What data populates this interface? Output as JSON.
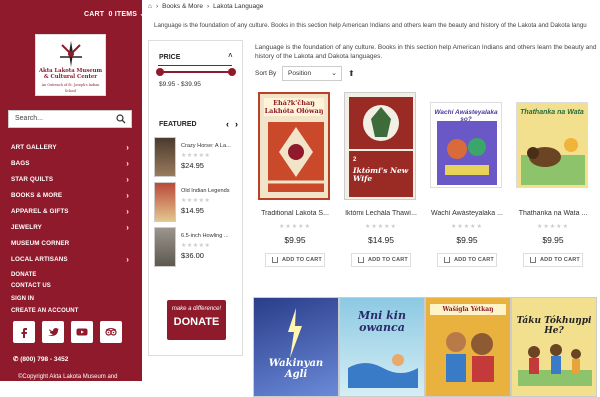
{
  "header": {
    "cart_label": "CART",
    "cart_items": "0 ITEMS"
  },
  "logo": {
    "line1": "Akta Lakota Museum",
    "line2": "& Cultural Center",
    "tagline": "An Outreach of St. Joseph's Indian School"
  },
  "search": {
    "placeholder": "Search..."
  },
  "nav": {
    "items": [
      {
        "label": "ART GALLERY"
      },
      {
        "label": "BAGS"
      },
      {
        "label": "STAR QUILTS"
      },
      {
        "label": "BOOKS & MORE"
      },
      {
        "label": "APPAREL & GIFTS"
      },
      {
        "label": "JEWELRY"
      },
      {
        "label": "MUSEUM CORNER"
      },
      {
        "label": "LOCAL ARTISANS"
      }
    ]
  },
  "links": {
    "items": [
      {
        "label": "DONATE"
      },
      {
        "label": "CONTACT US"
      },
      {
        "label": "SIGN IN"
      },
      {
        "label": "CREATE AN ACCOUNT"
      }
    ]
  },
  "social": [
    {
      "icon": "facebook-icon"
    },
    {
      "icon": "twitter-icon"
    },
    {
      "icon": "youtube-icon"
    },
    {
      "icon": "tripadvisor-icon"
    }
  ],
  "contact": {
    "phone": "(800) 798 - 3452",
    "copyright": "©Copyright Akta Lakota Museum and"
  },
  "breadcrumb": {
    "items": [
      "Books & More",
      "Lakota Language"
    ]
  },
  "description_top": "Language is the foundation of any culture. Books in this section help American Indians and others learn the beauty and history of the Lakota and Dakota langu",
  "description_main": "Language is the foundation of any culture. Books in this section help American Indians and others learn the beauty and history of the Lakota and Dakota languages.",
  "filters": {
    "price_title": "PRICE",
    "price_range": "$9.95 - $39.95",
    "price_min": 9.95,
    "price_max": 39.95,
    "featured_title": "FEATURED"
  },
  "featured": [
    {
      "name": "Crazy Horse: A La...",
      "price": "$24.95",
      "stars": "★★★★★"
    },
    {
      "name": "Old Indian Legends",
      "price": "$14.95",
      "stars": "★★★★★"
    },
    {
      "name": "6.5-inch Howling ...",
      "price": "$36.00",
      "stars": "★★★★★"
    }
  ],
  "donate": {
    "line1": "make a difference!",
    "line2": "DONATE"
  },
  "sort": {
    "label": "Sort By",
    "selected": "Position"
  },
  "products": [
    {
      "name": "Traditional Lakota S...",
      "price": "$9.95",
      "stars": "★★★★★",
      "button": "ADD TO CART",
      "cover_title": "Ehá?k'čhaŋ Lakhóta Ołówaŋ",
      "cover_color": "#c9492a"
    },
    {
      "name": "Iktómi Lechála Thawí...",
      "price": "$14.95",
      "stars": "★★★★★",
      "button": "ADD TO CART",
      "cover_title": "Iktómi's New Wife",
      "cover_color": "#9a2a24"
    },
    {
      "name": "Wachí Awásteyalaka ...",
      "price": "$9.95",
      "stars": "★★★★★",
      "button": "ADD TO CART",
      "cover_title": "Wachí Awásteyalaka so?",
      "cover_color": "#4b3d9a"
    },
    {
      "name": "Thathanka na Wata ...",
      "price": "$9.95",
      "stars": "★★★★★",
      "button": "ADD TO CART",
      "cover_title": "Thathanka na Wata",
      "cover_color": "#e8d88a"
    }
  ],
  "products_row2": [
    {
      "cover_title": "Wakinyan Agli",
      "cover_color": "#3d58b0"
    },
    {
      "cover_title": "Mni kin owanca",
      "cover_color": "#a9d2e6"
    },
    {
      "cover_title": "Wašígla Yétkaŋ",
      "cover_color": "#e9b23f"
    },
    {
      "cover_title": "Táku Tókhuŋpi He?",
      "cover_color": "#f2e08f"
    }
  ]
}
